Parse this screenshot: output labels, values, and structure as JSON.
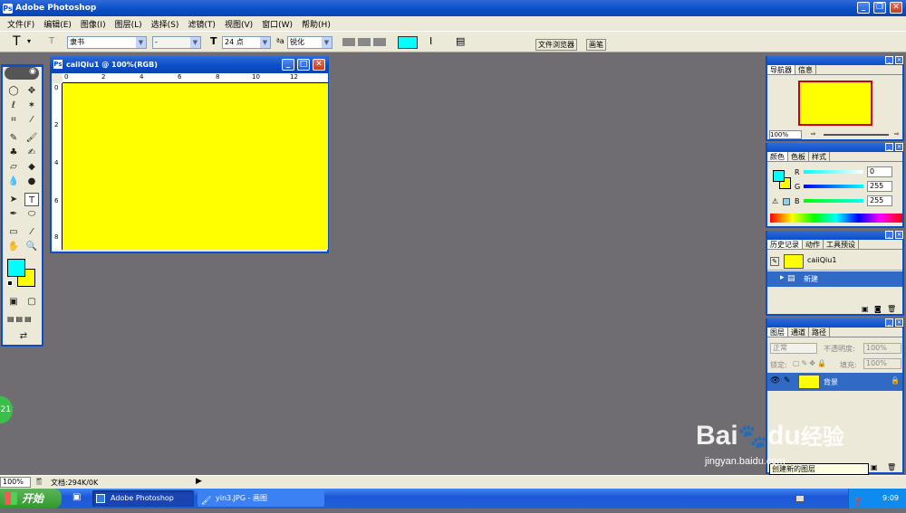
{
  "app": {
    "title": "Adobe Photoshop"
  },
  "menu": [
    "文件(F)",
    "编辑(E)",
    "图像(I)",
    "图层(L)",
    "选择(S)",
    "滤镜(T)",
    "视图(V)",
    "窗口(W)",
    "帮助(H)"
  ],
  "options": {
    "font_family": "隶书",
    "font_style": "-",
    "font_size": "24 点",
    "anti_alias": "锐化",
    "text_color": "#00ffff",
    "palette_tabs": [
      "文件浏览器",
      "画笔"
    ]
  },
  "document": {
    "title": "caiiQiu1 @ 100%(RGB)",
    "canvas_color": "#ffff00",
    "ruler_h": [
      "0",
      "2",
      "4",
      "6",
      "8",
      "10",
      "12"
    ],
    "ruler_v": [
      "0",
      "2",
      "4",
      "6",
      "8"
    ]
  },
  "toolbox": {
    "foreground": "#00ffff",
    "background": "#ffff00"
  },
  "navigator": {
    "tabs": [
      "导航器",
      "信息"
    ],
    "zoom": "100%"
  },
  "color_panel": {
    "tabs": [
      "颜色",
      "色板",
      "样式"
    ],
    "r_label": "R",
    "r_value": "0",
    "g_label": "G",
    "g_value": "255",
    "b_label": "B",
    "b_value": "255"
  },
  "history": {
    "tabs": [
      "历史记录",
      "动作",
      "工具预设"
    ],
    "snapshot": "caiiQiu1",
    "step": "新建"
  },
  "layers": {
    "tabs": [
      "图层",
      "通道",
      "路径"
    ],
    "blend_mode": "正常",
    "opacity_label": "不透明度:",
    "opacity_value": "100%",
    "lock_label": "锁定:",
    "fill_label": "填充:",
    "fill_value": "100%",
    "layer_name": "背景",
    "tooltip": "创建新的图层"
  },
  "status": {
    "zoom": "100%",
    "doc": "文档:294K/0K"
  },
  "taskbar": {
    "start": "开始",
    "tasks": [
      "Adobe Photoshop",
      "yin3.JPG - 画图"
    ],
    "time": "9:09"
  },
  "side_badge": "21",
  "watermark": {
    "brand": "Bai",
    "brand2": "du",
    "jingyan": "经验",
    "url": "jingyan.baidu.com"
  }
}
